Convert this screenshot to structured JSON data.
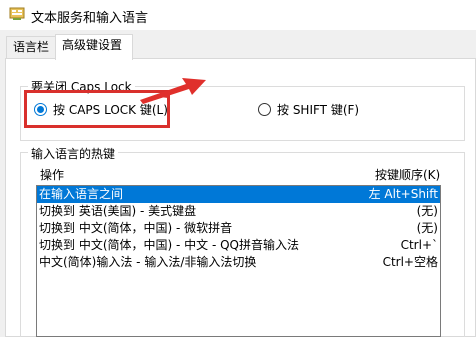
{
  "window": {
    "title": "文本服务和输入语言"
  },
  "tabs": [
    {
      "label": "语言栏"
    },
    {
      "label": "高级键设置"
    }
  ],
  "caps_group": {
    "title": "要关闭 Caps Lock",
    "options": [
      {
        "label": "按 CAPS LOCK 键(L)",
        "selected": true
      },
      {
        "label": "按 SHIFT 键(F)",
        "selected": false
      }
    ]
  },
  "hotkeys_group": {
    "title": "输入语言的热键",
    "col_action": "操作",
    "col_keys": "按键顺序(K)",
    "rows": [
      {
        "action": "在输入语言之间",
        "keys": "左 Alt+Shift",
        "selected": true
      },
      {
        "action": "切换到 英语(美国) - 美式键盘",
        "keys": "(无)",
        "selected": false
      },
      {
        "action": "切换到 中文(简体，中国) - 微软拼音",
        "keys": "(无)",
        "selected": false
      },
      {
        "action": "切换到 中文(简体，中国) - 中文 - QQ拼音输入法",
        "keys": "Ctrl+`",
        "selected": false
      },
      {
        "action": "中文(简体)输入法 - 输入法/非输入法切换",
        "keys": "Ctrl+空格",
        "selected": false
      }
    ]
  },
  "colors": {
    "selection": "#0078d7",
    "annotation": "#d9302c"
  }
}
